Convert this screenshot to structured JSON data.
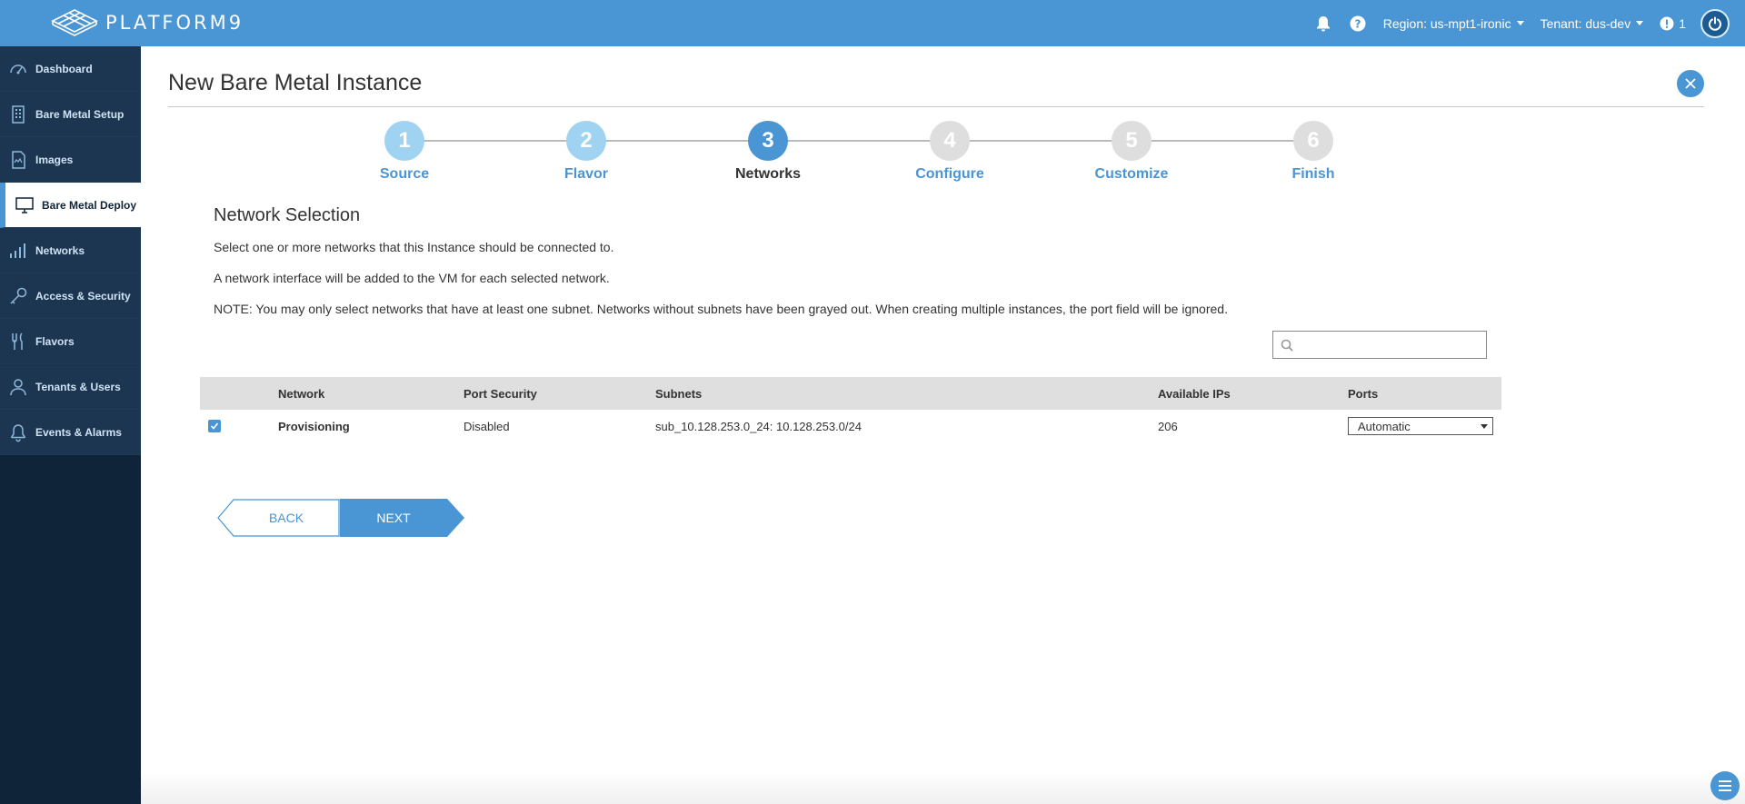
{
  "app": {
    "logo_text": "PLATFORM9",
    "region_label": "Region: us-mpt1-ironic",
    "tenant_label": "Tenant: dus-dev",
    "alert_count": "1",
    "colors": {
      "accent": "#4a95d3",
      "sidebar": "#0f2438"
    },
    "icons": [
      "bell-icon",
      "help-icon",
      "alert-icon",
      "power-icon"
    ]
  },
  "sidebar": {
    "items": [
      {
        "label": "Dashboard",
        "icon": "dashboard-icon"
      },
      {
        "label": "Bare Metal Setup",
        "icon": "building-icon"
      },
      {
        "label": "Images",
        "icon": "image-icon"
      },
      {
        "label": "Bare Metal Deploy",
        "icon": "monitor-icon",
        "active": true
      },
      {
        "label": "Networks",
        "icon": "signal-bars-icon"
      },
      {
        "label": "Access & Security",
        "icon": "key-icon"
      },
      {
        "label": "Flavors",
        "icon": "utensils-icon"
      },
      {
        "label": "Tenants & Users",
        "icon": "user-icon"
      },
      {
        "label": "Events & Alarms",
        "icon": "bell-outline-icon"
      }
    ]
  },
  "page": {
    "title": "New Bare Metal Instance",
    "steps": [
      {
        "num": "1",
        "label": "Source",
        "state": "done"
      },
      {
        "num": "2",
        "label": "Flavor",
        "state": "done"
      },
      {
        "num": "3",
        "label": "Networks",
        "state": "current"
      },
      {
        "num": "4",
        "label": "Configure",
        "state": "todo"
      },
      {
        "num": "5",
        "label": "Customize",
        "state": "todo"
      },
      {
        "num": "6",
        "label": "Finish",
        "state": "todo"
      }
    ],
    "section_title": "Network Selection",
    "para1": "Select one or more networks that this Instance should be connected to.",
    "para2": "A network interface will be added to the VM for each selected network.",
    "note": "NOTE: You may only select networks that have at least one subnet. Networks without subnets have been grayed out. When creating multiple instances, the port field will be ignored.",
    "search_placeholder": ""
  },
  "table": {
    "headers": [
      "Network",
      "Port Security",
      "Subnets",
      "Available IPs",
      "Ports"
    ],
    "rows": [
      {
        "checked": true,
        "network": "Provisioning",
        "port_security": "Disabled",
        "subnets": "sub_10.128.253.0_24: 10.128.253.0/24",
        "available_ips": "206",
        "ports": "Automatic"
      }
    ]
  },
  "buttons": {
    "back": "BACK",
    "next": "NEXT"
  }
}
